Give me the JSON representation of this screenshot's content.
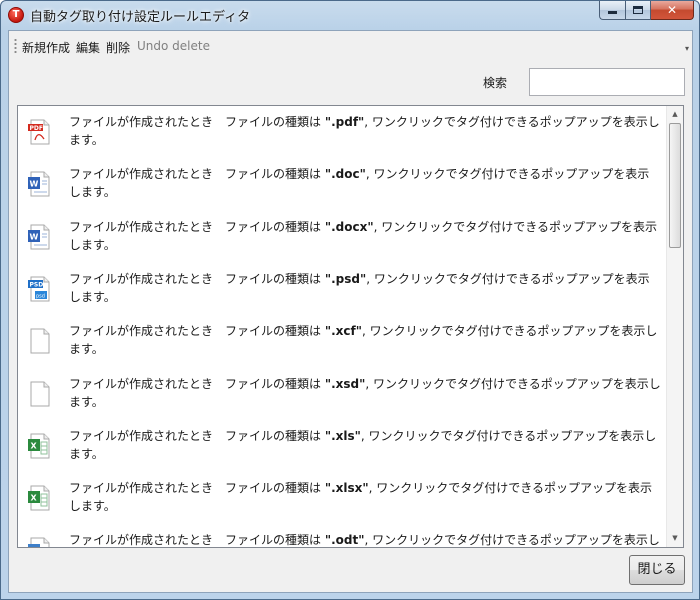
{
  "window": {
    "title": "自動タグ取り付け設定ルールエディタ",
    "app_icon_glyph": "T",
    "minimize_icon": "minimize-icon",
    "maximize_icon": "maximize-icon",
    "close_glyph": "✕"
  },
  "toolbar": {
    "new_label": "新規作成",
    "edit_label": "編集",
    "delete_label": "削除",
    "undo_label": "Undo delete",
    "overflow_glyph": "▾"
  },
  "search": {
    "label": "検索",
    "value": "",
    "placeholder": ""
  },
  "rules": [
    {
      "icon": "pdf-file-icon",
      "line1": "ファイルが作成されたとき　ファイルの種類は ",
      "ext": "\".pdf\"",
      "line2": ", ワンクリックでタグ付けできるポップアップを表示します。"
    },
    {
      "icon": "word-doc-icon",
      "line1": "ファイルが作成されたとき　ファイルの種類は ",
      "ext": "\".doc\"",
      "line2": ", ワンクリックでタグ付けできるポップアップを表示します。"
    },
    {
      "icon": "word-docx-icon",
      "line1": "ファイルが作成されたとき　ファイルの種類は ",
      "ext": "\".docx\"",
      "line2": ", ワンクリックでタグ付けできるポップアップを表示します。"
    },
    {
      "icon": "photoshop-psd-icon",
      "line1": "ファイルが作成されたとき　ファイルの種類は ",
      "ext": "\".psd\"",
      "line2": ", ワンクリックでタグ付けできるポップアップを表示します。"
    },
    {
      "icon": "blank-file-icon",
      "line1": "ファイルが作成されたとき　ファイルの種類は ",
      "ext": "\".xcf\"",
      "line2": ", ワンクリックでタグ付けできるポップアップを表示します。"
    },
    {
      "icon": "blank-file-icon",
      "line1": "ファイルが作成されたとき　ファイルの種類は ",
      "ext": "\".xsd\"",
      "line2": ", ワンクリックでタグ付けできるポップアップを表示します。"
    },
    {
      "icon": "excel-xls-icon",
      "line1": "ファイルが作成されたとき　ファイルの種類は ",
      "ext": "\".xls\"",
      "line2": ", ワンクリックでタグ付けできるポップアップを表示します。"
    },
    {
      "icon": "excel-xlsx-icon",
      "line1": "ファイルが作成されたとき　ファイルの種類は ",
      "ext": "\".xlsx\"",
      "line2": ", ワンクリックでタグ付けできるポップアップを表示します。"
    },
    {
      "icon": "odt-file-icon",
      "line1": "ファイルが作成されたとき　ファイルの種類は ",
      "ext": "\".odt\"",
      "line2": ", ワンクリックでタグ付けできるポップアップを表示します。"
    }
  ],
  "scrollbar": {
    "up_glyph": "▲",
    "down_glyph": "▼"
  },
  "footer": {
    "close_label": "閉じる"
  },
  "colors": {
    "pdf_red": "#d42a1e",
    "word_blue": "#2f62b8",
    "psd_blue": "#1f6fc7",
    "excel_green": "#2b8a3e"
  }
}
